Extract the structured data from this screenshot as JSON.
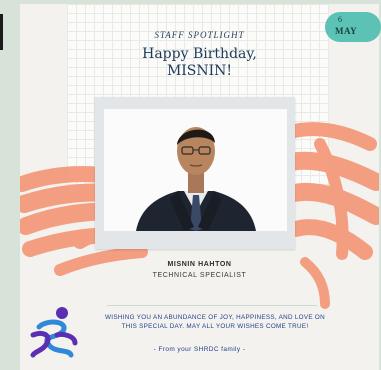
{
  "header": {
    "kicker": "STAFF SPOTLIGHT",
    "line1": "Happy Birthday,",
    "line2": "MISNIN!"
  },
  "date_badge": {
    "day": "6",
    "month": "MAY"
  },
  "staff": {
    "name": "MISNIN HAHTON",
    "title": "TECHNICAL SPECIALIST"
  },
  "message": {
    "wish_line1": "WISHING YOU AN ABUNDANCE OF JOY, HAPPINESS, AND LOVE ON",
    "wish_line2": "THIS SPECIAL DAY. MAY ALL YOUR WISHES COME TRUE!",
    "signoff": "- From your SHRDC family -"
  },
  "colors": {
    "brush": "#f59a7c",
    "badge": "#5dc2b6",
    "headline": "#1c3a59",
    "logo_purple": "#5a2fb3",
    "logo_blue": "#2f89d8"
  }
}
